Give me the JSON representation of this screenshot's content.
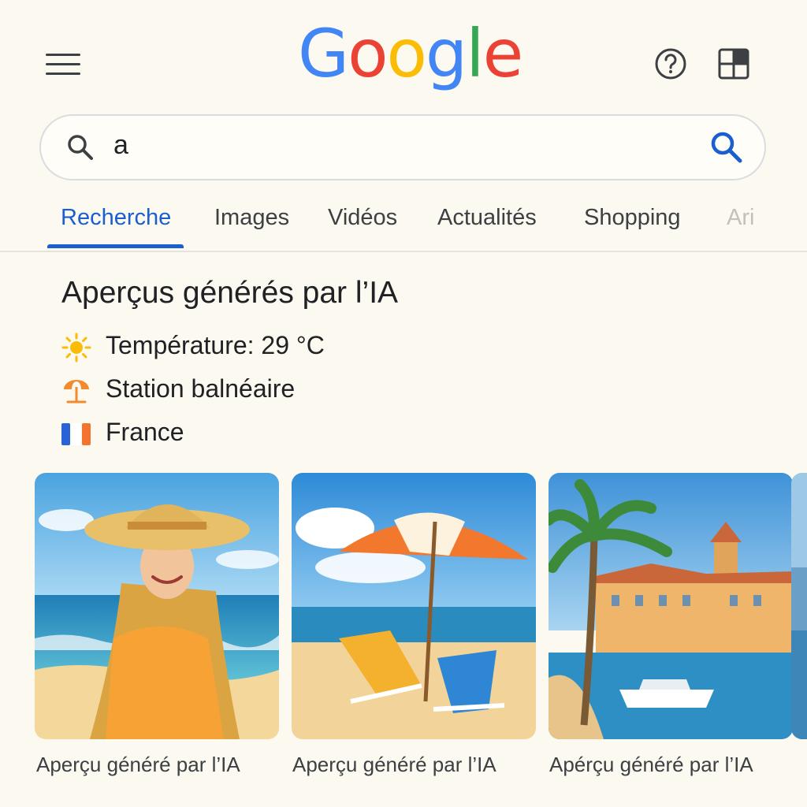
{
  "header": {
    "logo": [
      "G",
      "o",
      "o",
      "g",
      "l",
      "e"
    ],
    "logo_colors": [
      "#4285f4",
      "#ea4335",
      "#fbbc05",
      "#4285f4",
      "#34a853",
      "#ea4335"
    ]
  },
  "search": {
    "query": "a"
  },
  "tabs": [
    {
      "label": "Recherche"
    },
    {
      "label": "Images"
    },
    {
      "label": "Vidéos"
    },
    {
      "label": "Actualités"
    },
    {
      "label": "Shopping"
    },
    {
      "label": "Ari"
    }
  ],
  "ai_overview": {
    "title": "Aperçus générés par l’IA",
    "facts": [
      {
        "icon": "sun-icon",
        "text": "Température: 29 °C"
      },
      {
        "icon": "beach-umbrella-icon",
        "text": "Station balnéaire"
      },
      {
        "icon": "france-flag-icon",
        "text": "France"
      }
    ]
  },
  "cards": [
    {
      "image": "woman-beach-hat",
      "caption": "Aperçu généré par l’IA"
    },
    {
      "image": "beach-umbrella-chairs",
      "caption": "Aperçu généré par l’IA"
    },
    {
      "image": "palm-harbor-town",
      "caption": "Apérçu généré par l’IA"
    }
  ],
  "colors": {
    "accent": "#1a5fd0",
    "background": "#fcf9f1"
  }
}
